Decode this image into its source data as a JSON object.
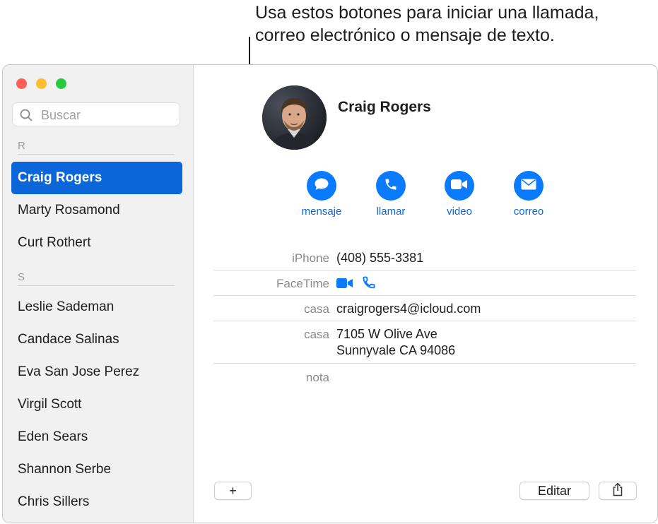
{
  "callout": {
    "line1": "Usa estos botones para iniciar una llamada,",
    "line2": "correo electrónico o mensaje de texto."
  },
  "search": {
    "placeholder": "Buscar"
  },
  "sidebar": {
    "sections": [
      {
        "letter": "R",
        "contacts": [
          "Craig Rogers",
          "Marty Rosamond",
          "Curt Rothert"
        ]
      },
      {
        "letter": "S",
        "contacts": [
          "Leslie Sademan",
          "Candace Salinas",
          "Eva San Jose Perez",
          "Virgil Scott",
          "Eden Sears",
          "Shannon Serbe",
          "Chris Sillers"
        ]
      }
    ],
    "selected": "Craig Rogers"
  },
  "contact": {
    "name": "Craig Rogers",
    "actions": [
      {
        "label": "mensaje",
        "icon": "message-bubble-icon"
      },
      {
        "label": "llamar",
        "icon": "phone-icon"
      },
      {
        "label": "video",
        "icon": "video-camera-icon"
      },
      {
        "label": "correo",
        "icon": "envelope-icon"
      }
    ],
    "fields": {
      "phone_label": "iPhone",
      "phone_value": "(408) 555-3381",
      "facetime_label": "FaceTime",
      "email_label": "casa",
      "email_value": "craigrogers4@icloud.com",
      "address_label": "casa",
      "address_line1": "7105 W Olive Ave",
      "address_line2": "Sunnyvale CA 94086",
      "note_label": "nota"
    }
  },
  "toolbar": {
    "add_label": "+",
    "edit_label": "Editar",
    "share_icon": "share-icon"
  },
  "colors": {
    "accent": "#0a7aff",
    "selection": "#0a66d9",
    "sidebar_bg": "#f1f1f1"
  }
}
